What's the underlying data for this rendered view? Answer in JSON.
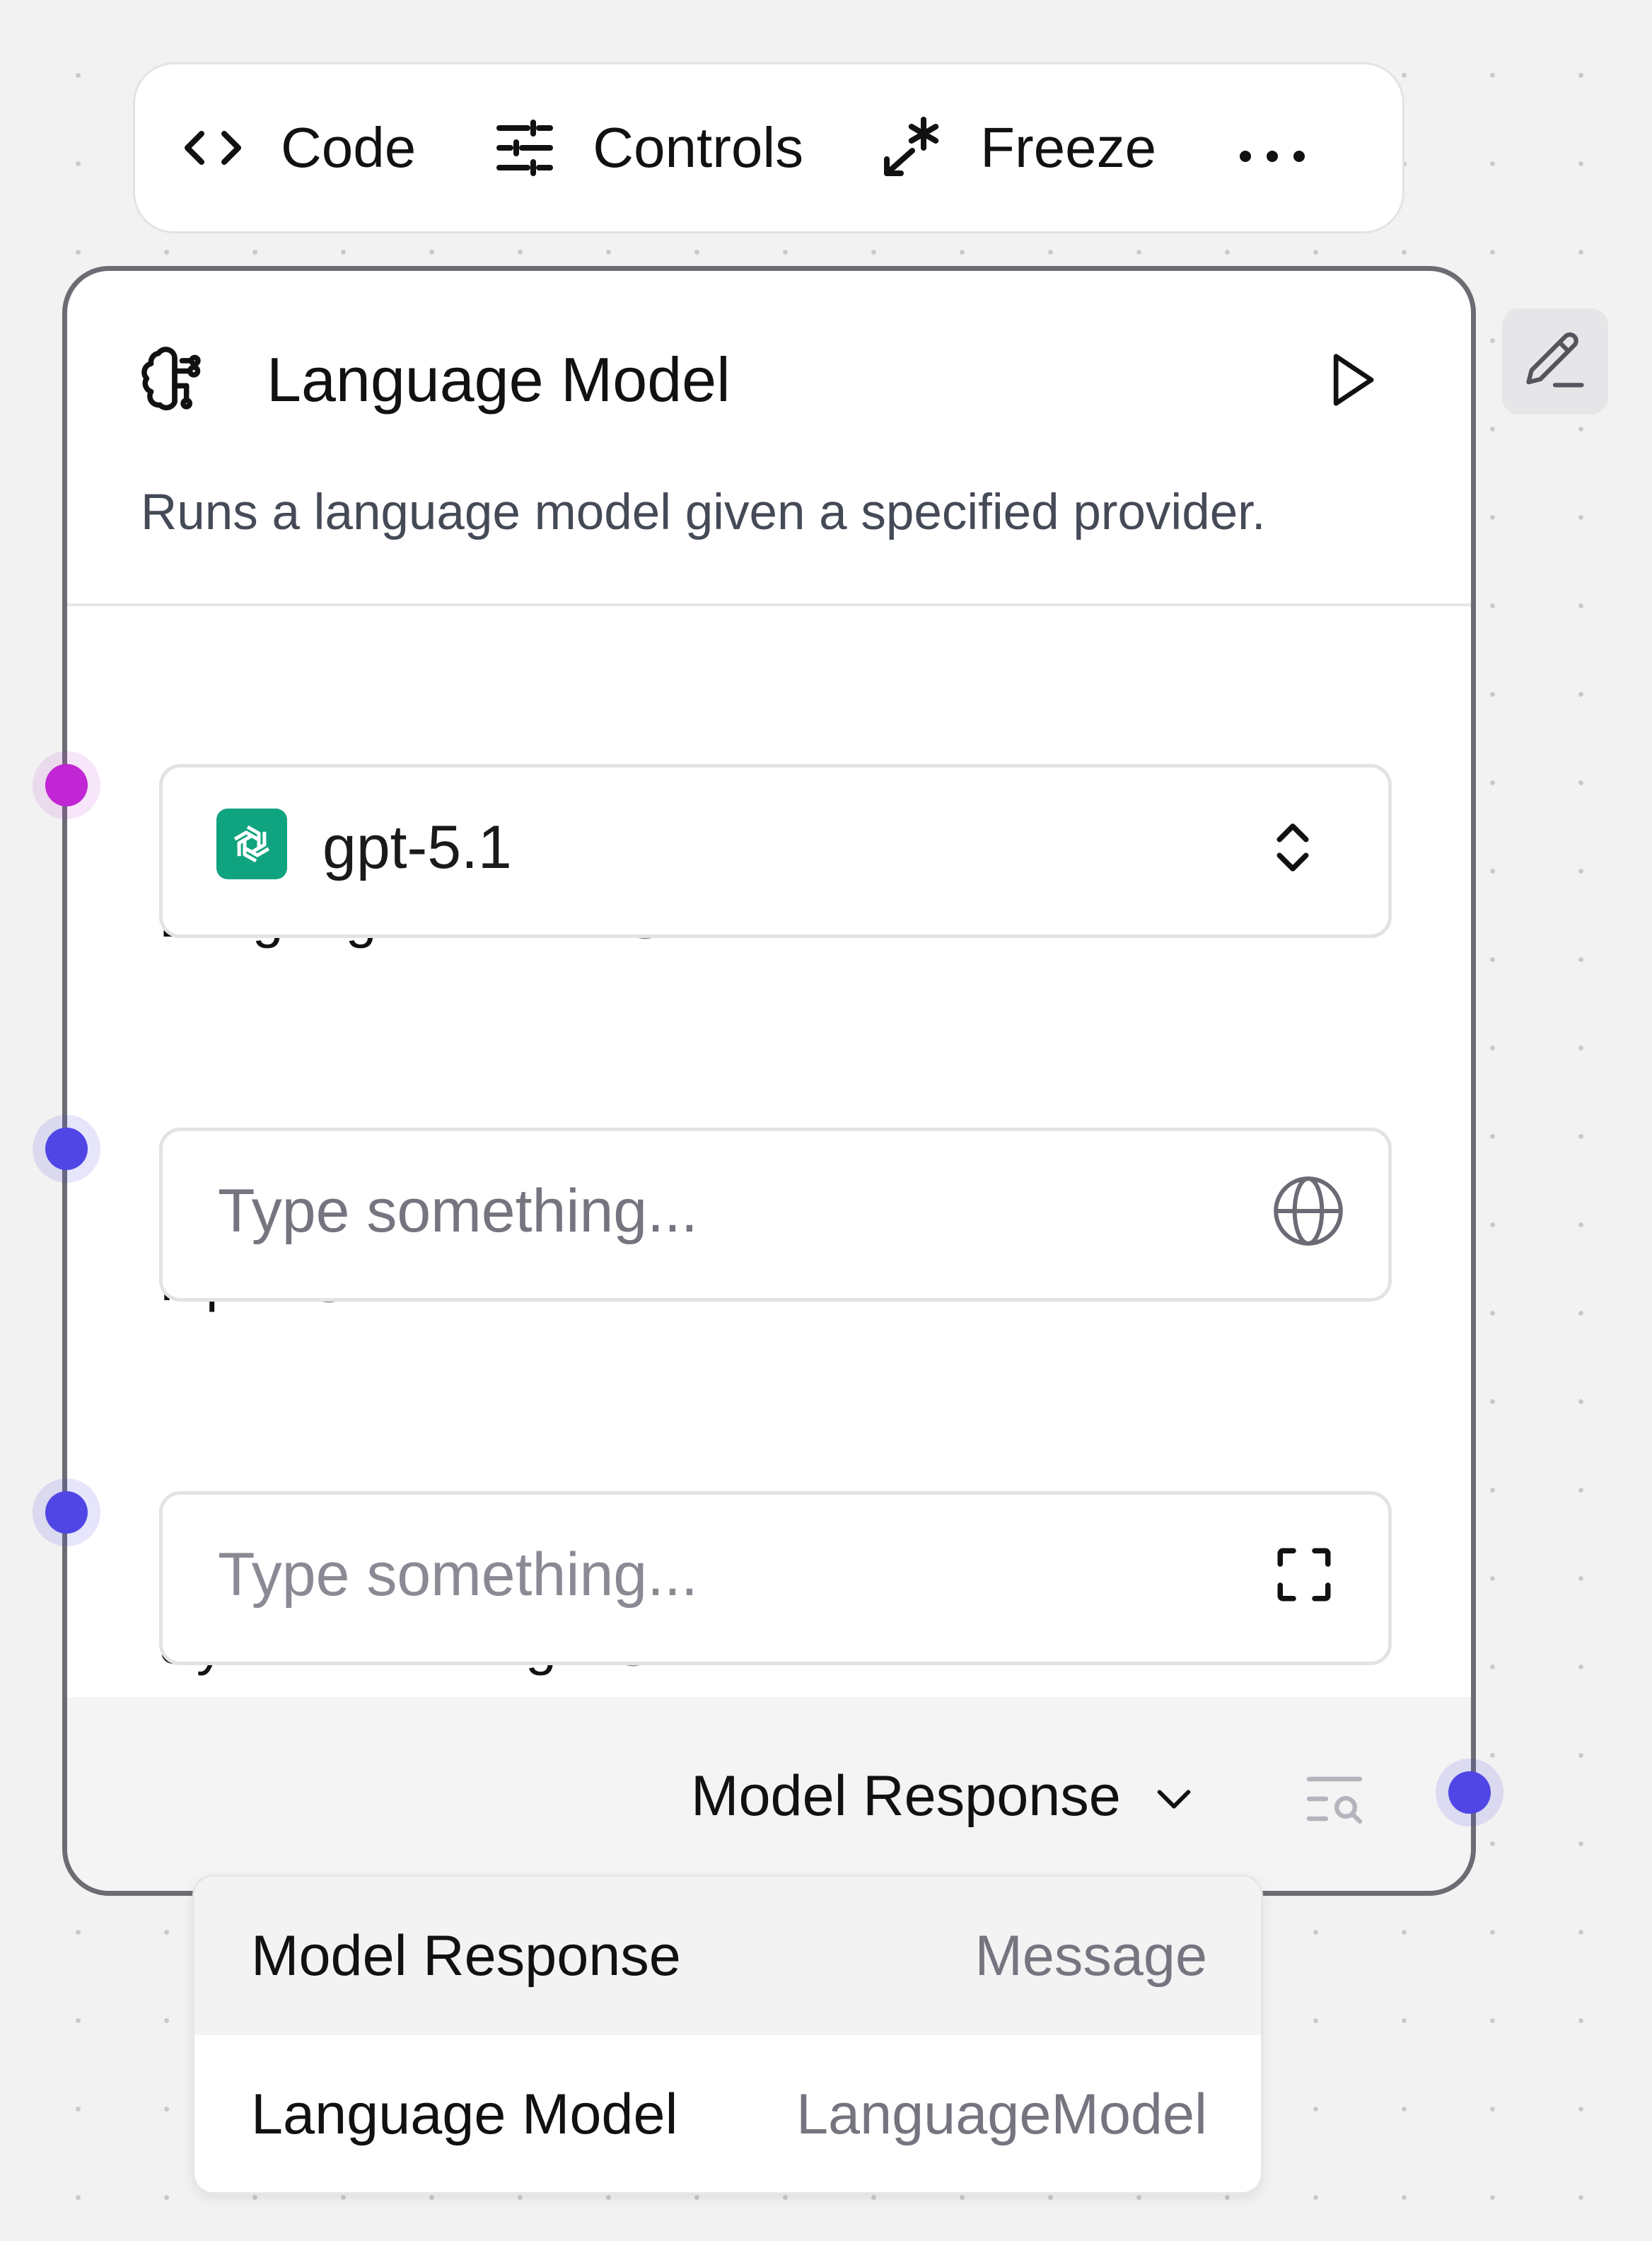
{
  "toolbar": {
    "code_label": "Code",
    "controls_label": "Controls",
    "freeze_label": "Freeze"
  },
  "node": {
    "title": "Language Model",
    "description": "Runs a language model given a specified provider.",
    "fields": {
      "language_model": {
        "label": "Language Model",
        "required_mark": "*",
        "value": "gpt-5.1"
      },
      "input": {
        "label": "Input",
        "placeholder": "Type something..."
      },
      "system_message": {
        "label": "System Message",
        "placeholder": "Type something..."
      }
    },
    "output": {
      "selected": "Model Response"
    }
  },
  "output_menu": {
    "items": [
      {
        "label": "Model Response",
        "type": "Message"
      },
      {
        "label": "Language Model",
        "type": "LanguageModel"
      }
    ]
  },
  "colors": {
    "model_handle": "#c026d3",
    "data_handle": "#4f46e5",
    "required": "#ef4444",
    "openai_green": "#10a37f",
    "node_border": "#6c6c73"
  },
  "icons": {
    "code": "code-brackets-icon",
    "controls": "sliders-icon",
    "freeze": "snowflake-icon",
    "more": "more-horizontal-icon",
    "node": "brain-circuit-icon",
    "run": "play-icon",
    "info": "info-icon",
    "provider": "openai-icon",
    "stepper": "chevrons-up-down-icon",
    "globe": "globe-icon",
    "expand": "expand-icon",
    "chevron": "chevron-down-icon",
    "inspect": "text-search-icon",
    "edit": "pencil-icon"
  }
}
